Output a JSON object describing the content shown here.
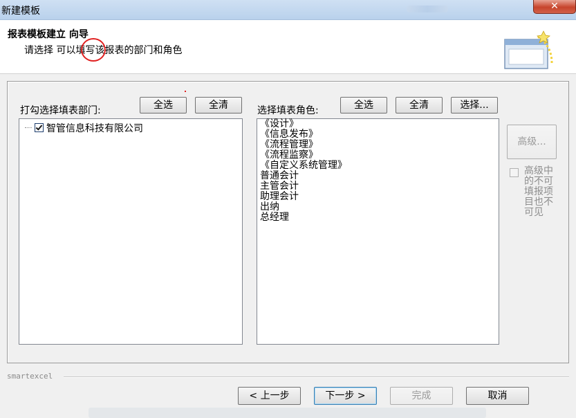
{
  "window": {
    "title": "新建模板",
    "close_glyph": "✕"
  },
  "header": {
    "heading": "报表模板建立  向导",
    "subtitle": "请选择  可以填写该报表的部门和角色"
  },
  "departments": {
    "label": "打勾选择填表部门:",
    "select_all": "全选",
    "clear_all": "全清",
    "items": [
      {
        "name": "智管信息科技有限公司",
        "checked": true
      }
    ]
  },
  "roles": {
    "label": "选择填表角色:",
    "select_all": "全选",
    "clear_all": "全清",
    "choose": "选择...",
    "items": [
      "《设计》",
      "《信息发布》",
      "《流程管理》",
      "《流程监察》",
      "《自定义系统管理》",
      "普通会计",
      "主管会计",
      "助理会计",
      "出纳",
      "总经理"
    ]
  },
  "advanced": {
    "button": "高级...",
    "hide_label": "高级中的不可填报项目也不可见",
    "hide_checked": false
  },
  "footer": {
    "brand": "smartexcel",
    "prev": "< 上一步",
    "next": "下一步 >",
    "finish": "完成",
    "cancel": "取消"
  },
  "colors": {
    "titlebar": "#b9d1ec",
    "close_button": "#c7452c",
    "annotation_circle": "#e02020"
  }
}
